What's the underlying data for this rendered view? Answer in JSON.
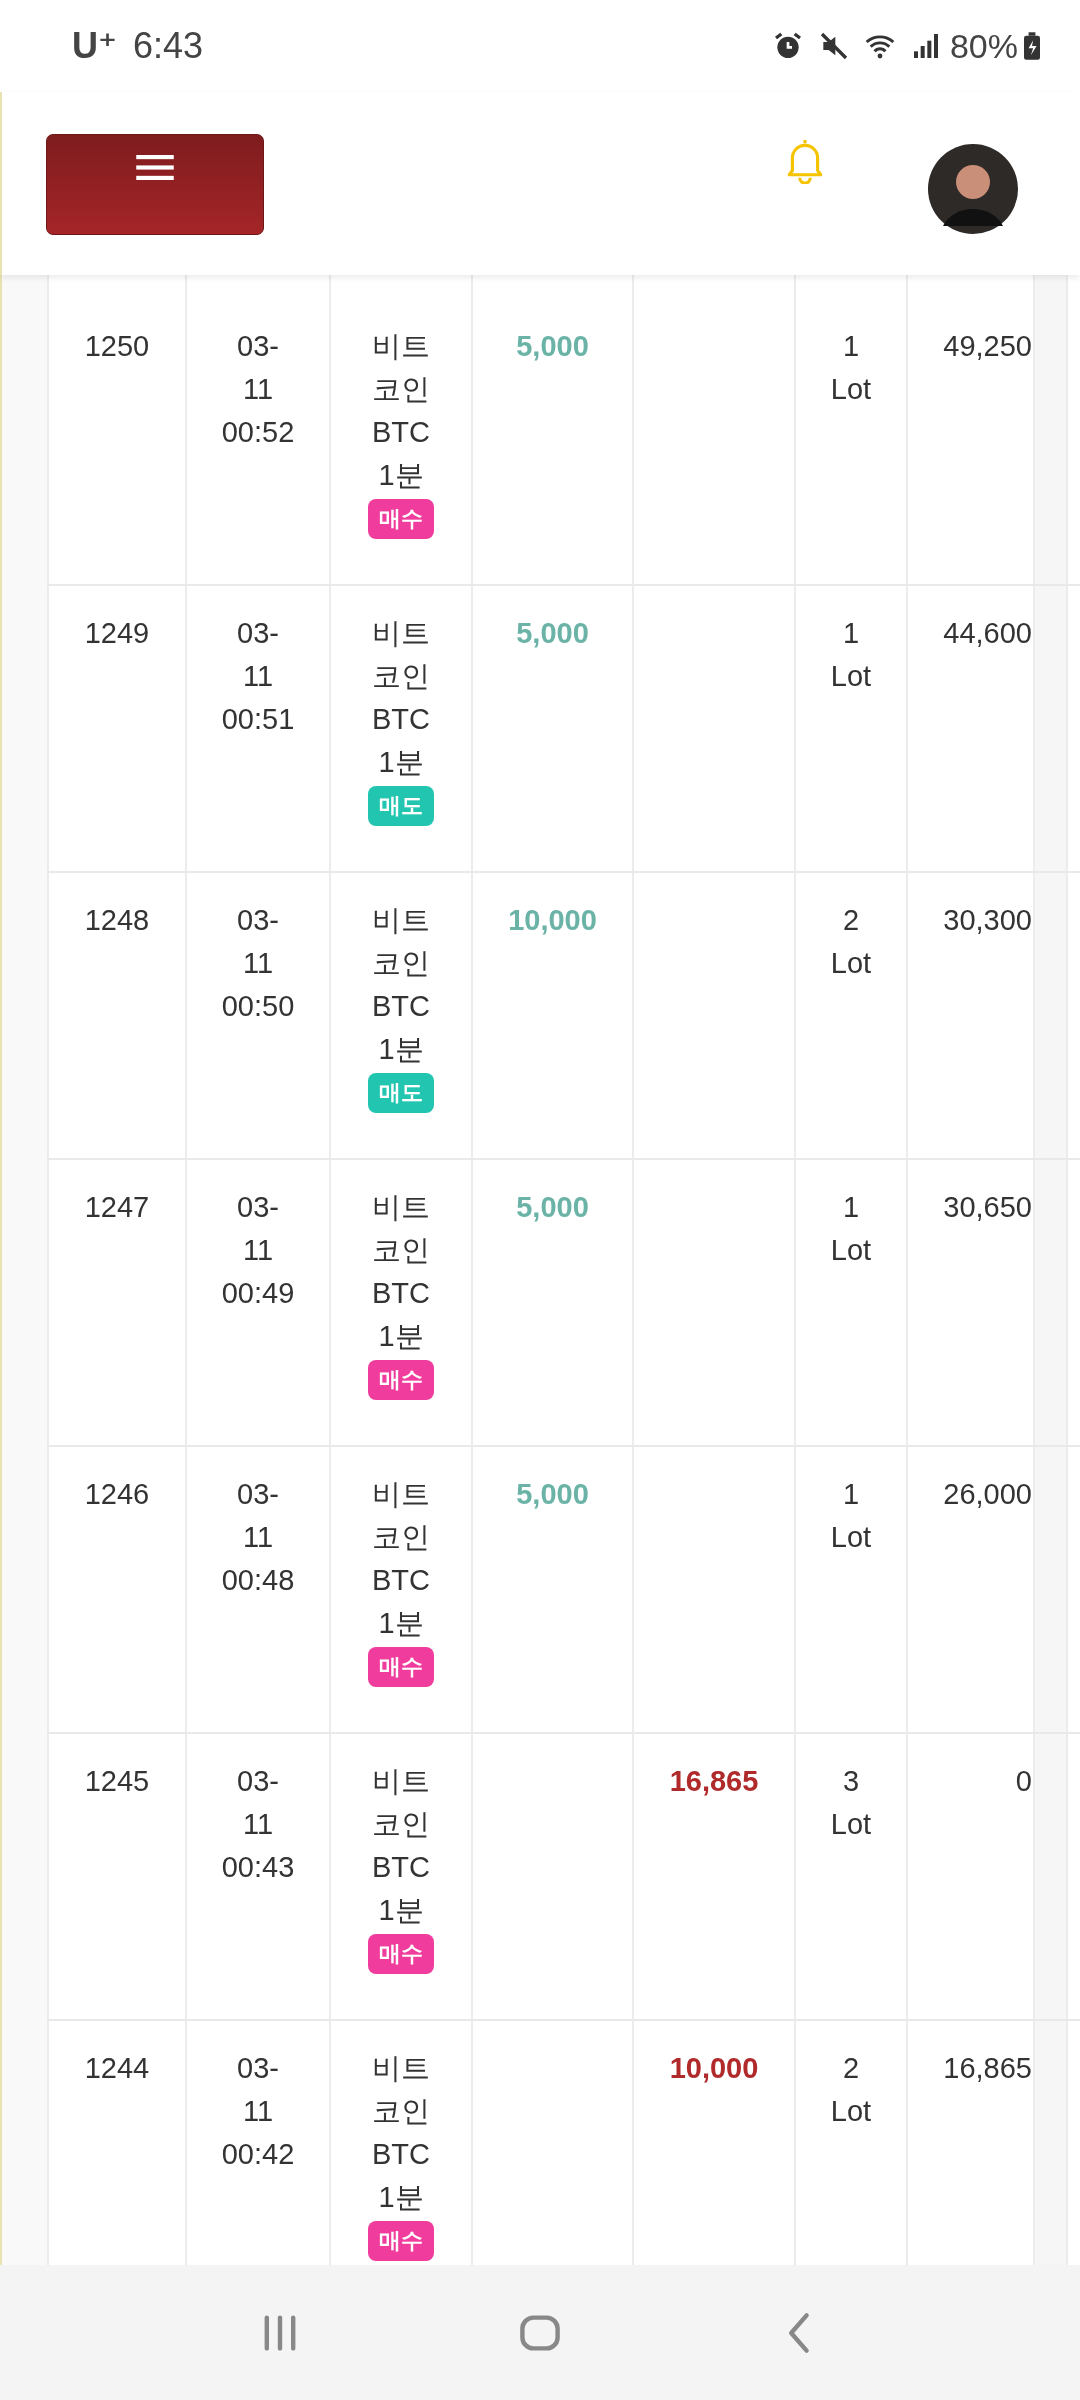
{
  "status_bar": {
    "carrier": "U⁺",
    "time": "6:43",
    "battery": "80%"
  },
  "rows": [
    {
      "number": "1250",
      "datetime": "03-\n11\n00:52",
      "symbol": "비트\n코인\nBTC\n1분",
      "badge": {
        "label": "매수",
        "kind": "buy"
      },
      "column_4": "5,000",
      "quantity": "1\nLot",
      "column_7": "49,250"
    },
    {
      "number": "1249",
      "datetime": "03-\n11\n00:51",
      "symbol": "비트\n코인\nBTC\n1분",
      "badge": {
        "label": "매도",
        "kind": "sell"
      },
      "column_4": "5,000",
      "quantity": "1\nLot",
      "column_7": "44,600"
    },
    {
      "number": "1248",
      "datetime": "03-\n11\n00:50",
      "symbol": "비트\n코인\nBTC\n1분",
      "badge": {
        "label": "매도",
        "kind": "sell"
      },
      "column_4": "10,000",
      "quantity": "2\nLot",
      "column_7": "30,300"
    },
    {
      "number": "1247",
      "datetime": "03-\n11\n00:49",
      "symbol": "비트\n코인\nBTC\n1분",
      "badge": {
        "label": "매수",
        "kind": "buy"
      },
      "column_4": "5,000",
      "quantity": "1\nLot",
      "column_7": "30,650"
    },
    {
      "number": "1246",
      "datetime": "03-\n11\n00:48",
      "symbol": "비트\n코인\nBTC\n1분",
      "badge": {
        "label": "매수",
        "kind": "buy"
      },
      "column_4": "5,000",
      "quantity": "1\nLot",
      "column_7": "26,000"
    },
    {
      "number": "1245",
      "datetime": "03-\n11\n00:43",
      "symbol": "비트\n코인\nBTC\n1분",
      "badge": {
        "label": "매수",
        "kind": "buy"
      },
      "column_5": "16,865",
      "quantity": "3\nLot",
      "column_7": "0"
    },
    {
      "number": "1244",
      "datetime": "03-\n11\n00:42",
      "symbol": "비트\n코인\nBTC\n1분",
      "badge": {
        "label": "매수",
        "kind": "buy"
      },
      "column_5": "10,000",
      "quantity": "2\nLot",
      "column_7": "16,865"
    }
  ]
}
